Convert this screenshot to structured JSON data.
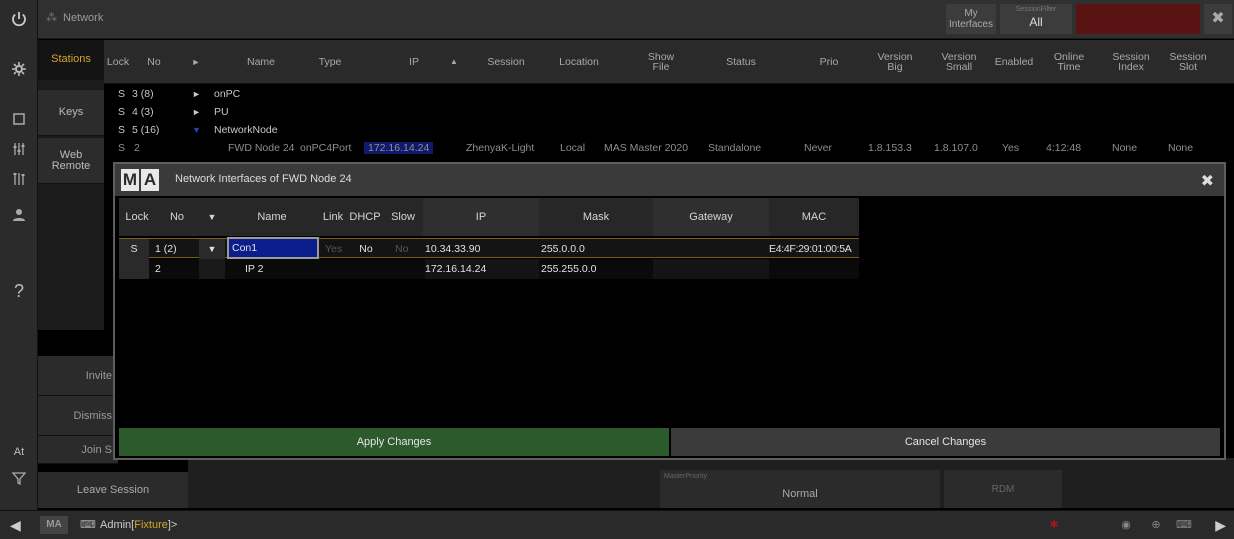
{
  "window": {
    "title": "Network",
    "my_interfaces": "My Interfaces",
    "session_filter_label": "SessionFilter",
    "session_filter_value": "All"
  },
  "sidebar_tabs": [
    "Stations",
    "Keys",
    "Web Remote"
  ],
  "left_rail": {
    "items": [
      "power-icon",
      "gear-icon",
      "layers-icon",
      "faders-icon",
      "sliders-icon",
      "user-icon",
      "help-icon",
      "at-icon",
      "filter-icon"
    ],
    "help": "?",
    "at": "At"
  },
  "stations": {
    "columns": [
      "Lock",
      "No",
      "►",
      "Name",
      "Type",
      "IP",
      "▲",
      "Session",
      "Location",
      "Show File",
      "Status",
      "Prio",
      "Version Big",
      "Version Small",
      "Enabled",
      "Online Time",
      "Session Index",
      "Session Slot"
    ],
    "rows": [
      {
        "lock": "S",
        "no": "3 (8)",
        "arrow": "►",
        "name": "onPC"
      },
      {
        "lock": "S",
        "no": "4 (3)",
        "arrow": "►",
        "name": "PU"
      },
      {
        "lock": "S",
        "no": "5 (16)",
        "arrow": "▼",
        "name": "NetworkNode"
      },
      {
        "lock": "S",
        "no": "2",
        "name": "FWD Node 24",
        "type": "onPC4Port",
        "ip": "172.16.14.24",
        "session": "ZhenyaK-Light",
        "location": "Local",
        "showfile": "MAS Master 2020",
        "status": "Standalone",
        "prio": "Never",
        "vbig": "1.8.153.3",
        "vsmall": "1.8.107.0",
        "enabled": "Yes",
        "online": "4:12:48",
        "sindex": "None",
        "sslot": "None"
      }
    ]
  },
  "commands": {
    "invite": "Invite",
    "dismiss": "Dismiss",
    "join": "Join S",
    "leave": "Leave Session",
    "master_priority_label": "MasterPriority",
    "master_priority_value": "Normal",
    "rdm": "RDM"
  },
  "command_line": {
    "logo": "MA",
    "prefix": "Admin[",
    "context": "Fixture",
    "suffix": "]>"
  },
  "dialog": {
    "logo": [
      "M",
      "A"
    ],
    "title": "Network Interfaces of FWD Node 24",
    "columns": [
      "Lock",
      "No",
      "▼",
      "Name",
      "Link",
      "DHCP",
      "Slow",
      "IP",
      "Mask",
      "Gateway",
      "MAC"
    ],
    "rows": [
      {
        "lock": "S",
        "no": "1 (2)",
        "arrow": "▼",
        "name": "Con1",
        "link": "Yes",
        "dhcp": "No",
        "slow": "No",
        "ip": "10.34.33.90",
        "mask": "255.0.0.0",
        "gateway": "",
        "mac": "E4:4F:29:01:00:5A"
      },
      {
        "lock": "",
        "no": "2",
        "arrow": "",
        "name": "IP 2",
        "link": "",
        "dhcp": "",
        "slow": "",
        "ip": "172.16.14.24",
        "mask": "255.255.0.0",
        "gateway": "",
        "mac": ""
      }
    ],
    "apply": "Apply Changes",
    "cancel": "Cancel Changes"
  },
  "colors": {
    "accent_gold": "#d7a52c",
    "apply_green": "#2c5a2c",
    "selection_blue": "#0c1d8c"
  }
}
